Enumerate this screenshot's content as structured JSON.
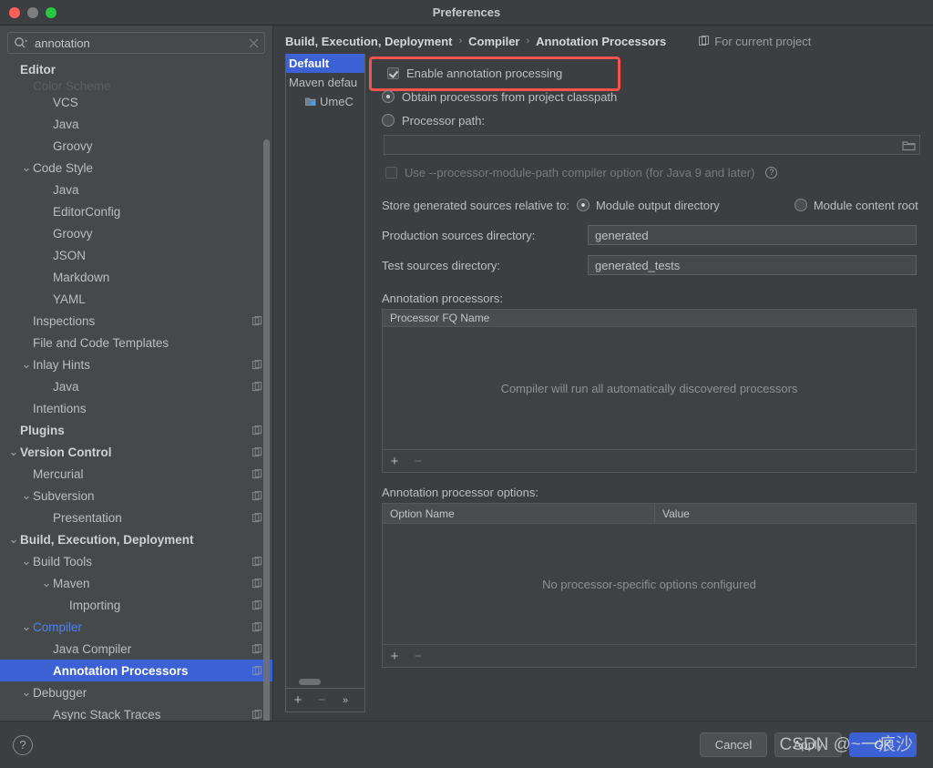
{
  "window": {
    "title": "Preferences",
    "traffic_lights": [
      "close",
      "minimize",
      "maximize"
    ]
  },
  "search": {
    "value": "annotation",
    "placeholder": "Search settings",
    "icon": "search-icon",
    "clear_icon": "close-icon"
  },
  "sidebar": {
    "items": [
      {
        "label": "Editor",
        "indent": 0,
        "bold": true,
        "arrow": "",
        "project_icon": false,
        "state": "normal"
      },
      {
        "label": "Color Scheme",
        "indent": 1,
        "bold": false,
        "arrow": "",
        "project_icon": false,
        "state": "cutoff"
      },
      {
        "label": "VCS",
        "indent": 2,
        "bold": false,
        "arrow": "",
        "project_icon": false,
        "state": "normal"
      },
      {
        "label": "Java",
        "indent": 2,
        "bold": false,
        "arrow": "",
        "project_icon": false,
        "state": "normal"
      },
      {
        "label": "Groovy",
        "indent": 2,
        "bold": false,
        "arrow": "",
        "project_icon": false,
        "state": "normal"
      },
      {
        "label": "Code Style",
        "indent": 1,
        "bold": false,
        "arrow": "expanded",
        "project_icon": false,
        "state": "normal"
      },
      {
        "label": "Java",
        "indent": 2,
        "bold": false,
        "arrow": "",
        "project_icon": false,
        "state": "normal"
      },
      {
        "label": "EditorConfig",
        "indent": 2,
        "bold": false,
        "arrow": "",
        "project_icon": false,
        "state": "normal"
      },
      {
        "label": "Groovy",
        "indent": 2,
        "bold": false,
        "arrow": "",
        "project_icon": false,
        "state": "normal"
      },
      {
        "label": "JSON",
        "indent": 2,
        "bold": false,
        "arrow": "",
        "project_icon": false,
        "state": "normal"
      },
      {
        "label": "Markdown",
        "indent": 2,
        "bold": false,
        "arrow": "",
        "project_icon": false,
        "state": "normal"
      },
      {
        "label": "YAML",
        "indent": 2,
        "bold": false,
        "arrow": "",
        "project_icon": false,
        "state": "normal"
      },
      {
        "label": "Inspections",
        "indent": 1,
        "bold": false,
        "arrow": "",
        "project_icon": true,
        "state": "normal"
      },
      {
        "label": "File and Code Templates",
        "indent": 1,
        "bold": false,
        "arrow": "",
        "project_icon": false,
        "state": "normal"
      },
      {
        "label": "Inlay Hints",
        "indent": 1,
        "bold": false,
        "arrow": "expanded",
        "project_icon": true,
        "state": "normal"
      },
      {
        "label": "Java",
        "indent": 2,
        "bold": false,
        "arrow": "",
        "project_icon": true,
        "state": "normal"
      },
      {
        "label": "Intentions",
        "indent": 1,
        "bold": false,
        "arrow": "",
        "project_icon": false,
        "state": "normal"
      },
      {
        "label": "Plugins",
        "indent": 0,
        "bold": true,
        "arrow": "",
        "project_icon": true,
        "state": "normal"
      },
      {
        "label": "Version Control",
        "indent": 0,
        "bold": true,
        "arrow": "expanded",
        "project_icon": true,
        "state": "normal"
      },
      {
        "label": "Mercurial",
        "indent": 1,
        "bold": false,
        "arrow": "",
        "project_icon": true,
        "state": "normal"
      },
      {
        "label": "Subversion",
        "indent": 1,
        "bold": false,
        "arrow": "expanded",
        "project_icon": true,
        "state": "normal"
      },
      {
        "label": "Presentation",
        "indent": 2,
        "bold": false,
        "arrow": "",
        "project_icon": true,
        "state": "normal"
      },
      {
        "label": "Build, Execution, Deployment",
        "indent": 0,
        "bold": true,
        "arrow": "expanded",
        "project_icon": false,
        "state": "normal"
      },
      {
        "label": "Build Tools",
        "indent": 1,
        "bold": false,
        "arrow": "expanded",
        "project_icon": true,
        "state": "normal"
      },
      {
        "label": "Maven",
        "indent": 2,
        "bold": false,
        "arrow": "expanded",
        "project_icon": true,
        "state": "normal"
      },
      {
        "label": "Importing",
        "indent": 3,
        "bold": false,
        "arrow": "",
        "project_icon": true,
        "state": "normal"
      },
      {
        "label": "Compiler",
        "indent": 1,
        "bold": false,
        "arrow": "expanded",
        "project_icon": true,
        "state": "blue"
      },
      {
        "label": "Java Compiler",
        "indent": 2,
        "bold": false,
        "arrow": "",
        "project_icon": true,
        "state": "normal"
      },
      {
        "label": "Annotation Processors",
        "indent": 2,
        "bold": false,
        "arrow": "",
        "project_icon": true,
        "state": "selected"
      },
      {
        "label": "Debugger",
        "indent": 1,
        "bold": false,
        "arrow": "expanded",
        "project_icon": false,
        "state": "normal"
      },
      {
        "label": "Async Stack Traces",
        "indent": 2,
        "bold": false,
        "arrow": "",
        "project_icon": true,
        "state": "normal"
      }
    ]
  },
  "breadcrumb": {
    "parts": [
      "Build, Execution, Deployment",
      "Compiler",
      "Annotation Processors"
    ],
    "separator": "›",
    "scope_label": "For current project",
    "scope_icon": "project-scope-icon"
  },
  "profiles": {
    "items": [
      {
        "label": "Default",
        "selected": true,
        "module_icon": false
      },
      {
        "label": "Maven defau",
        "selected": false,
        "module_icon": false
      },
      {
        "label": "UmeC",
        "selected": false,
        "module_icon": true
      }
    ],
    "toolbar": {
      "add_label": "+",
      "remove_label": "−",
      "more_label": "»"
    }
  },
  "settings": {
    "enable_annotation_processing": {
      "label": "Enable annotation processing",
      "checked": true,
      "highlight_color": "#f4534e"
    },
    "source_mode": {
      "selected": "classpath",
      "options": [
        {
          "key": "classpath",
          "label": "Obtain processors from project classpath",
          "checked": true
        },
        {
          "key": "path",
          "label": "Processor path:",
          "checked": false
        }
      ]
    },
    "processor_path": {
      "value": "",
      "placeholder": "",
      "browse_icon": "folder-icon",
      "enabled": false
    },
    "processor_module_path": {
      "label": "Use --processor-module-path compiler option (for Java 9 and later)",
      "checked": false,
      "enabled": false,
      "help_icon": "help-circle-icon",
      "help_label": "?"
    },
    "store_generated": {
      "label": "Store generated sources relative to:",
      "options": [
        {
          "key": "module_output",
          "label": "Module output directory",
          "checked": true
        },
        {
          "key": "module_content",
          "label": "Module content root",
          "checked": false
        }
      ]
    },
    "production_sources": {
      "label": "Production sources directory:",
      "value": "generated"
    },
    "test_sources": {
      "label": "Test sources directory:",
      "value": "generated_tests"
    },
    "annotation_processors": {
      "label": "Annotation processors:",
      "columns": [
        "Processor FQ Name"
      ],
      "rows": [],
      "empty_text": "Compiler will run all automatically discovered processors",
      "toolbar": {
        "add_label": "+",
        "remove_label": "−"
      }
    },
    "processor_options": {
      "label": "Annotation processor options:",
      "columns": [
        "Option Name",
        "Value"
      ],
      "rows": [],
      "empty_text": "No processor-specific options configured",
      "toolbar": {
        "add_label": "+",
        "remove_label": "−"
      }
    }
  },
  "bottom_bar": {
    "help_label": "?",
    "help_icon": "help-circle-icon",
    "buttons": [
      {
        "key": "cancel",
        "label": "Cancel",
        "primary": false
      },
      {
        "key": "apply",
        "label": "Apply",
        "primary": false
      },
      {
        "key": "ok",
        "label": "OK",
        "primary": true
      }
    ]
  },
  "watermark": {
    "text": "CSDN @~一痕沙"
  },
  "colors": {
    "window_bg": "#3c3f41",
    "sidebar_bg": "#45494a",
    "selection_blue": "#3b61d4",
    "link_blue": "#4d81f5",
    "highlight_red": "#f4534e",
    "text": "#bbbbbb"
  }
}
